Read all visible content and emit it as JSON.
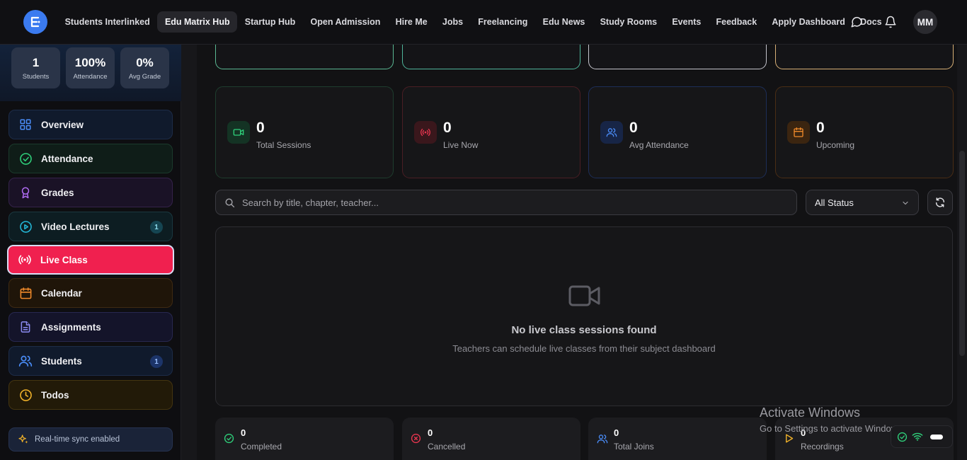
{
  "nav": {
    "items": [
      "Students Interlinked",
      "Edu Matrix Hub",
      "Startup Hub",
      "Open Admission",
      "Hire Me",
      "Jobs",
      "Freelancing",
      "Edu News",
      "Study Rooms",
      "Events",
      "Feedback",
      "Apply Dashboard",
      "Docs"
    ],
    "active": "Edu Matrix Hub",
    "avatar": "MM"
  },
  "sidebar": {
    "stats": [
      {
        "value": "1",
        "label": "Students"
      },
      {
        "value": "100%",
        "label": "Attendance"
      },
      {
        "value": "0%",
        "label": "Avg Grade"
      }
    ],
    "items": [
      {
        "label": "Overview",
        "icon": "grid-icon",
        "color": "#4a8cf7"
      },
      {
        "label": "Attendance",
        "icon": "check-circle-icon",
        "color": "#2fcf7a"
      },
      {
        "label": "Grades",
        "icon": "award-icon",
        "color": "#b06cf4"
      },
      {
        "label": "Video Lectures",
        "icon": "play-circle-icon",
        "color": "#24b6d6",
        "badge": "1"
      },
      {
        "label": "Live Class",
        "icon": "broadcast-icon",
        "color": "#ffffff",
        "active": true
      },
      {
        "label": "Calendar",
        "icon": "calendar-icon",
        "color": "#f08a2a"
      },
      {
        "label": "Assignments",
        "icon": "file-text-icon",
        "color": "#8c8cf4"
      },
      {
        "label": "Students",
        "icon": "users-icon",
        "color": "#4a8cf7",
        "badge": "1"
      },
      {
        "label": "Todos",
        "icon": "clock-icon",
        "color": "#f2b32a"
      }
    ],
    "sync_label": "Real-time sync enabled"
  },
  "stats": [
    {
      "value": "0",
      "label": "Total Sessions",
      "icon": "video-icon",
      "color": "#2fcf7a"
    },
    {
      "value": "0",
      "label": "Live Now",
      "icon": "broadcast-icon",
      "color": "#e8354f"
    },
    {
      "value": "0",
      "label": "Avg Attendance",
      "icon": "users-icon",
      "color": "#4a8cf7"
    },
    {
      "value": "0",
      "label": "Upcoming",
      "icon": "calendar-icon",
      "color": "#f08a2a"
    }
  ],
  "search": {
    "placeholder": "Search by title, chapter, teacher..."
  },
  "filter": {
    "selected": "All Status"
  },
  "empty": {
    "title": "No live class sessions found",
    "subtitle": "Teachers can schedule live classes from their subject dashboard"
  },
  "bottom_stats": [
    {
      "value": "0",
      "label": "Completed",
      "icon": "check-circle-icon",
      "color": "#2fcf7a"
    },
    {
      "value": "0",
      "label": "Cancelled",
      "icon": "x-circle-icon",
      "color": "#e8354f"
    },
    {
      "value": "0",
      "label": "Total Joins",
      "icon": "users-icon",
      "color": "#4a8cf7"
    },
    {
      "value": "0",
      "label": "Recordings",
      "icon": "play-icon",
      "color": "#f2b32a"
    }
  ],
  "watermark": {
    "line1": "Activate Windows",
    "line2": "Go to Settings to activate Windows."
  }
}
